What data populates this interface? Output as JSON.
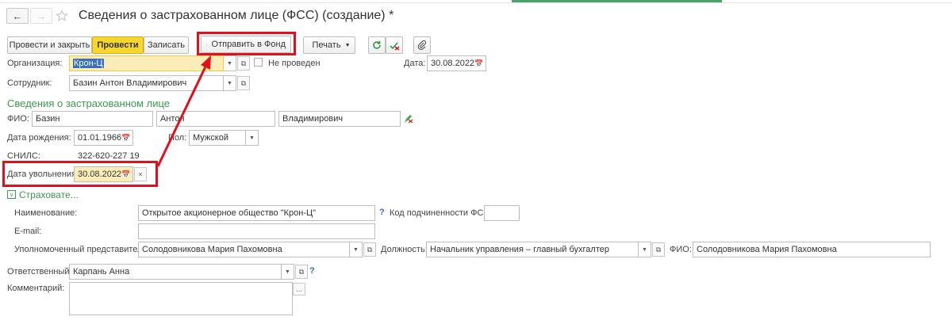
{
  "window": {
    "title": "Сведения о застрахованном лице (ФСС) (создание) *"
  },
  "nav": {
    "back_glyph": "←",
    "forward_glyph": "→"
  },
  "toolbar": {
    "post_close": "Провести и закрыть",
    "post": "Провести",
    "save": "Записать",
    "send_fund": "Отправить в Фонд",
    "print": "Печать"
  },
  "org": {
    "label": "Организация:",
    "value": "Крон-Ц",
    "status": "Не проведен"
  },
  "date": {
    "label": "Дата:",
    "value": "30.08.2022"
  },
  "employee": {
    "label": "Сотрудник:",
    "value": "Базин Антон Владимирович"
  },
  "insured_section": {
    "title": "Сведения о застрахованном лице"
  },
  "fio": {
    "label": "ФИО:",
    "last": "Базин",
    "first": "Антон",
    "middle": "Владимирович"
  },
  "birth": {
    "label": "Дата рождения:",
    "value": "01.01.1966"
  },
  "gender": {
    "label": "Пол:",
    "value": "Мужской"
  },
  "snils": {
    "label": "СНИЛС:",
    "value": "322-620-227 19"
  },
  "dismissal": {
    "label": "Дата увольнения:",
    "value": "30.08.2022"
  },
  "insurer_section": {
    "title": "Страховате...",
    "name_label": "Наименование:",
    "name_value": "Открытое акционерное общество \"Крон-Ц\"",
    "subordination_label": "Код подчиненности ФСС:",
    "subordination_value": "",
    "email_label": "E-mail:",
    "email_value": "",
    "rep_label": "Уполномоченный представитель:",
    "rep_value": "Солодовникова Мария Пахомовна",
    "position_label": "Должность:",
    "position_value": "Начальник управления – главный бухгалтер",
    "fio_label": "ФИО:",
    "fio_value": "Солодовникова Мария Пахомовна"
  },
  "responsible": {
    "label": "Ответственный:",
    "value": "Карпань Анна"
  },
  "comment": {
    "label": "Комментарий:",
    "value": "",
    "more": "..."
  },
  "help_mark": "?",
  "colors": {
    "highlight_red": "#e0101e",
    "accent_green": "#3d9a51",
    "primary_yellow": "#f7d62d"
  }
}
